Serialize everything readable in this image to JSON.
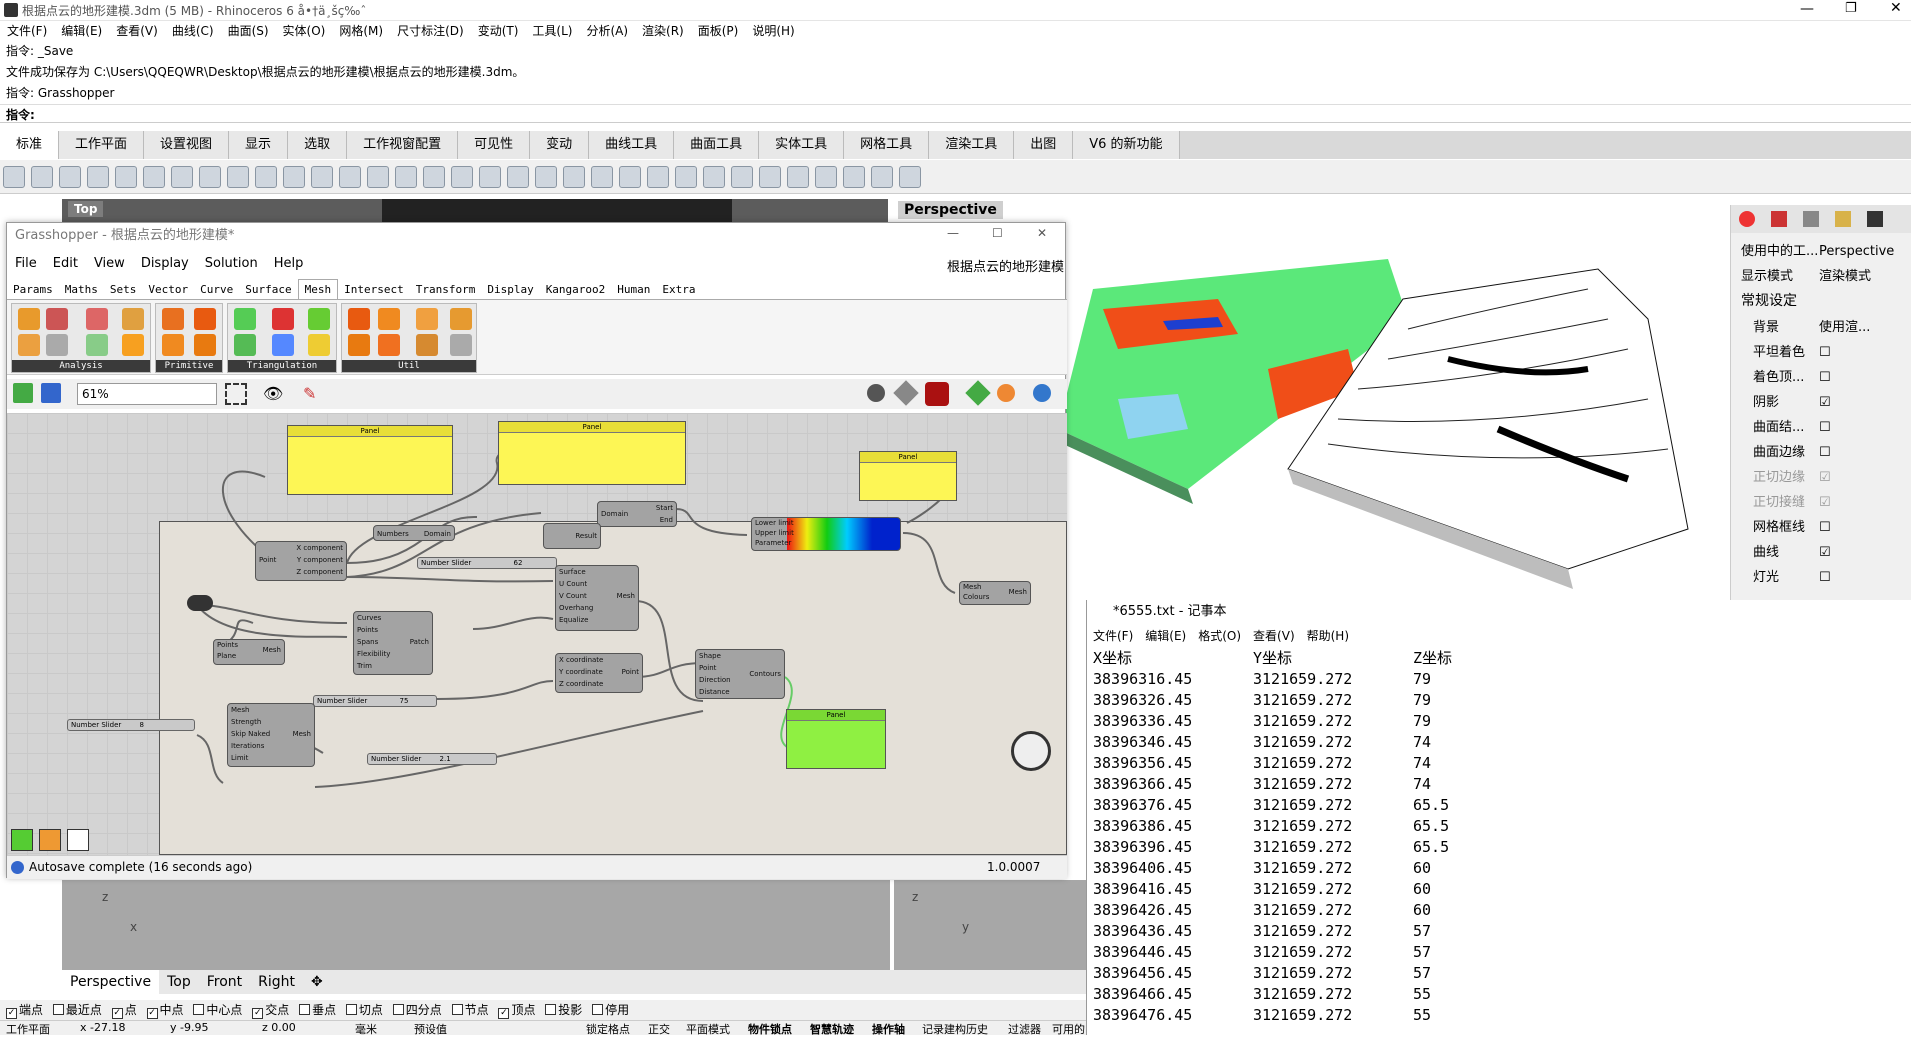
{
  "window": {
    "title": "根据点云的地形建模.3dm (5 MB) - Rhinoceros 6 å•†ä¸šç‰ˆ"
  },
  "menu": [
    "文件(F)",
    "编辑(E)",
    "查看(V)",
    "曲线(C)",
    "曲面(S)",
    "实体(O)",
    "网格(M)",
    "尺寸标注(D)",
    "变动(T)",
    "工具(L)",
    "分析(A)",
    "渲染(R)",
    "面板(P)",
    "说明(H)"
  ],
  "command": {
    "line1": "指令: _Save",
    "line2": "文件成功保存为 C:\\Users\\QQEQWR\\Desktop\\根据点云的地形建模\\根据点云的地形建模.3dm。",
    "line3": "指令: Grasshopper",
    "prompt": "指令:"
  },
  "tabs": [
    "标准",
    "工作平面",
    "设置视图",
    "显示",
    "选取",
    "工作视窗配置",
    "可见性",
    "变动",
    "曲线工具",
    "曲面工具",
    "实体工具",
    "网格工具",
    "渲染工具",
    "出图",
    "V6 的新功能"
  ],
  "viewports": {
    "top": "Top",
    "perspective": "Perspective"
  },
  "bottom_tabs": [
    "Perspective",
    "Top",
    "Front",
    "Right"
  ],
  "right_panel": {
    "viewport_row": {
      "k": "使用中的工...",
      "v": "Perspective"
    },
    "display_row": {
      "k": "显示模式",
      "v": "渲染模式"
    },
    "section": "常规设定",
    "background": {
      "k": "背景",
      "v": "使用渲..."
    },
    "options": [
      {
        "k": "平坦着色",
        "v": "☐"
      },
      {
        "k": "着色顶...",
        "v": "☐"
      },
      {
        "k": "阴影",
        "v": "☑"
      },
      {
        "k": "曲面结...",
        "v": "☐"
      },
      {
        "k": "曲面边缘",
        "v": "☐"
      },
      {
        "k": "正切边缘",
        "v": "☑"
      },
      {
        "k": "正切接缝",
        "v": "☑"
      },
      {
        "k": "网格框线",
        "v": "☐"
      },
      {
        "k": "曲线",
        "v": "☑"
      },
      {
        "k": "灯光",
        "v": "☐"
      }
    ]
  },
  "osnap": [
    {
      "label": "端点",
      "on": "✓"
    },
    {
      "label": "最近点",
      "on": ""
    },
    {
      "label": "点",
      "on": "✓"
    },
    {
      "label": "中点",
      "on": "✓"
    },
    {
      "label": "中心点",
      "on": ""
    },
    {
      "label": "交点",
      "on": "✓"
    },
    {
      "label": "垂点",
      "on": ""
    },
    {
      "label": "切点",
      "on": ""
    },
    {
      "label": "四分点",
      "on": ""
    },
    {
      "label": "节点",
      "on": ""
    },
    {
      "label": "顶点",
      "on": "✓"
    },
    {
      "label": "投影",
      "on": ""
    },
    {
      "label": "停用",
      "on": ""
    }
  ],
  "status": {
    "plane": "工作平面",
    "x": "x -27.18",
    "y": "y -9.95",
    "z": "z 0.00",
    "unit": "毫米",
    "layer": "预设值",
    "items": [
      "锁定格点",
      "正交",
      "平面模式",
      "物件锁点",
      "智慧轨迹",
      "操作轴",
      "记录建构历史",
      "过滤器",
      "可用的"
    ]
  },
  "gh": {
    "title": "Grasshopper - 根据点云的地形建模*",
    "menu": [
      "File",
      "Edit",
      "View",
      "Display",
      "Solution",
      "Help"
    ],
    "doc": "根据点云的地形建模",
    "tabs": [
      "Params",
      "Maths",
      "Sets",
      "Vector",
      "Curve",
      "Surface",
      "Mesh",
      "Intersect",
      "Transform",
      "Display",
      "Kangaroo2",
      "Human",
      "Extra"
    ],
    "groups": [
      "Analysis",
      "Primitive",
      "Triangulation",
      "Util"
    ],
    "zoom": "61%",
    "status": "Autosave complete (16 seconds ago)",
    "version": "1.0.0007",
    "components": {
      "panel": "Panel",
      "domain": "Domain",
      "start": "Start",
      "end": "End",
      "numbers": "Numbers",
      "result": "Result",
      "lower": "Lower limit",
      "upper": "Upper limit",
      "parameter": "Parameter",
      "mesh": "Mesh",
      "colours": "Colours",
      "point": "Point",
      "xc": "X component",
      "yc": "Y component",
      "zc": "Z component",
      "slider": "Number Slider",
      "s62": "62",
      "surface": "Surface",
      "ucount": "U Count",
      "vcount": "V Count",
      "overhang": "Overhang",
      "equalize": "Equalize",
      "curves": "Curves",
      "points": "Points",
      "spans": "Spans",
      "flex": "Flexibility",
      "trim": "Trim",
      "patch": "Patch",
      "plane": "Plane",
      "xcoord": "X coordinate",
      "ycoord": "Y coordinate",
      "zcoord": "Z coordinate",
      "shape": "Shape",
      "direction": "Direction",
      "distance": "Distance",
      "contours": "Contours",
      "strength": "Strength",
      "skip": "Skip Naked",
      "iterations": "Iterations",
      "limit": "Limit",
      "s75": "75",
      "s21": "2.1",
      "s8": "8"
    }
  },
  "notepad": {
    "title": "*6555.txt - 记事本",
    "menu": [
      "文件(F)",
      "编辑(E)",
      "格式(O)",
      "查看(V)",
      "帮助(H)"
    ],
    "headers": [
      "X坐标",
      "Y坐标",
      "Z坐标"
    ],
    "rows": [
      [
        "38396316.45",
        "3121659.272",
        "79"
      ],
      [
        "38396326.45",
        "3121659.272",
        "79"
      ],
      [
        "38396336.45",
        "3121659.272",
        "79"
      ],
      [
        "38396346.45",
        "3121659.272",
        "74"
      ],
      [
        "38396356.45",
        "3121659.272",
        "74"
      ],
      [
        "38396366.45",
        "3121659.272",
        "74"
      ],
      [
        "38396376.45",
        "3121659.272",
        "65.5"
      ],
      [
        "38396386.45",
        "3121659.272",
        "65.5"
      ],
      [
        "38396396.45",
        "3121659.272",
        "65.5"
      ],
      [
        "38396406.45",
        "3121659.272",
        "60"
      ],
      [
        "38396416.45",
        "3121659.272",
        "60"
      ],
      [
        "38396426.45",
        "3121659.272",
        "60"
      ],
      [
        "38396436.45",
        "3121659.272",
        "57"
      ],
      [
        "38396446.45",
        "3121659.272",
        "57"
      ],
      [
        "38396456.45",
        "3121659.272",
        "57"
      ],
      [
        "38396466.45",
        "3121659.272",
        "55"
      ],
      [
        "38396476.45",
        "3121659.272",
        "55"
      ]
    ]
  }
}
